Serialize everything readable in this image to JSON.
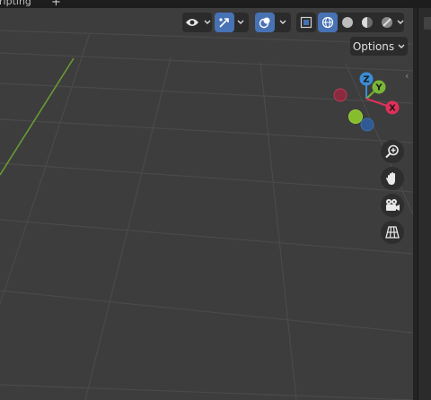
{
  "tabs": {
    "scripting_label": "Scripting",
    "add_label": "+"
  },
  "header": {
    "options_label": "Options",
    "accent": "#4772b3"
  },
  "gizmo": {
    "x_label": "X",
    "y_label": "Y",
    "z_label": "Z",
    "colors": {
      "x": "#e0305a",
      "y": "#7ab637",
      "z": "#3b8cd6",
      "neg_x": "#8a2a3e",
      "neg_y": "#8ecb2c",
      "neg_z": "#2f5a93"
    }
  },
  "navigation": {
    "buttons": [
      "zoom-icon",
      "hand-pan-icon",
      "camera-icon",
      "grid-perspective-icon"
    ]
  },
  "colors": {
    "viewport_bg": "#3d3d3d",
    "grid_line": "#4f4f4f",
    "y_axis_line": "#6a9a34"
  }
}
